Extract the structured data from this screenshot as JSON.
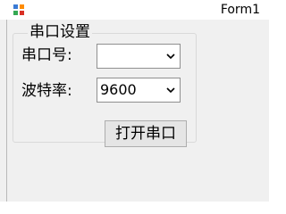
{
  "window": {
    "title": "Form1"
  },
  "groupbox": {
    "title": "串口设置"
  },
  "fields": {
    "port": {
      "label": "串口号:",
      "value": ""
    },
    "baud": {
      "label": "波特率:",
      "value": "9600"
    }
  },
  "actions": {
    "open_port_label": "打开串口"
  },
  "icons": {
    "app": "app-icon",
    "dropdown": "chevron-down-icon"
  },
  "colors": {
    "window_bg": "#f0f0f0",
    "titlebar_bg": "#ffffff",
    "button_bg": "#e5e5e5",
    "border": "#adadad"
  }
}
